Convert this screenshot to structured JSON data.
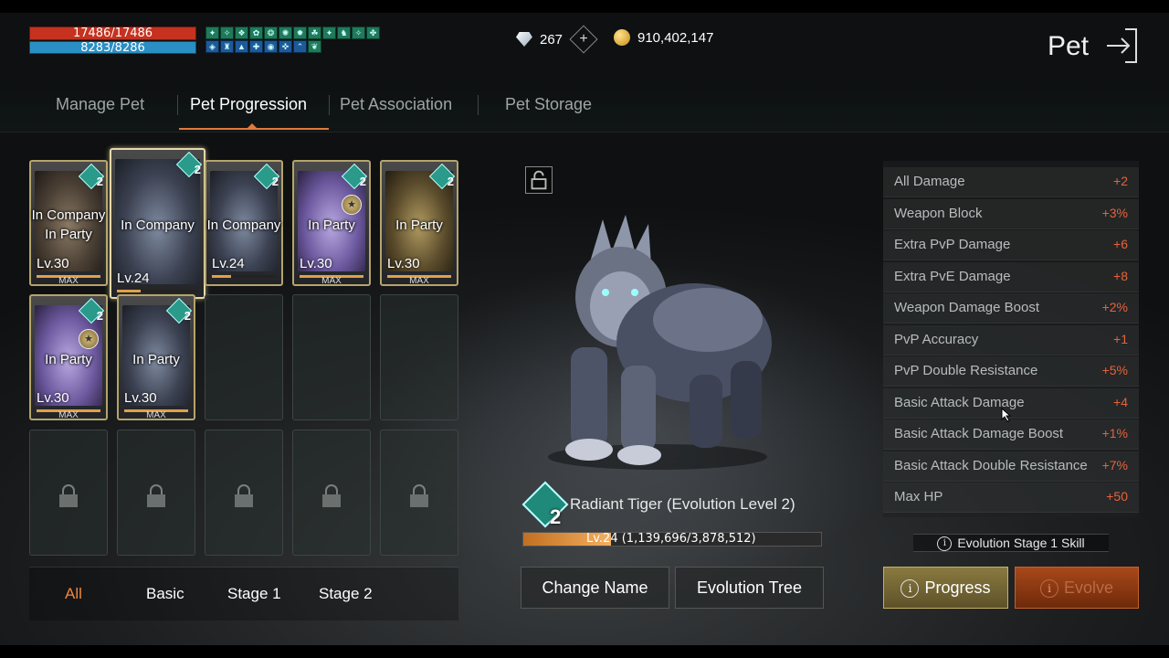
{
  "status": {
    "hp": "17486/17486",
    "mp": "8283/8286"
  },
  "buff_icons": [
    "buff-icon",
    "buff-icon",
    "buff-icon",
    "buff-icon",
    "buff-icon",
    "buff-icon",
    "buff-icon",
    "buff-icon",
    "buff-icon",
    "buff-icon",
    "buff-icon",
    "buff-icon",
    "buff-icon",
    "buff-icon",
    "buff-icon",
    "buff-icon",
    "buff-icon",
    "buff-icon",
    "buff-icon",
    "buff-icon",
    "buff-icon",
    "buff-icon",
    "buff-icon",
    "buff-icon"
  ],
  "currency": {
    "gems": "267",
    "gold": "910,402,147"
  },
  "page_title": "Pet",
  "tabs": [
    {
      "label": "Manage Pet"
    },
    {
      "label": "Pet Progression"
    },
    {
      "label": "Pet Association"
    },
    {
      "label": "Pet Storage"
    }
  ],
  "pets": [
    {
      "status1": "In Company",
      "status2": "In Party",
      "level": "Lv.30",
      "max": "MAX",
      "badge": "2",
      "xp": 1.0
    },
    {
      "status1": "In Company",
      "status2": "",
      "level": "Lv.24",
      "max": "",
      "badge": "2",
      "xp": 0.29
    },
    {
      "status1": "In Company",
      "status2": "",
      "level": "Lv.24",
      "max": "",
      "badge": "2",
      "xp": 0.3
    },
    {
      "status1": "In Party",
      "status2": "",
      "level": "Lv.30",
      "max": "MAX",
      "badge": "2",
      "xp": 1.0
    },
    {
      "status1": "In Party",
      "status2": "",
      "level": "Lv.30",
      "max": "MAX",
      "badge": "2",
      "xp": 1.0
    },
    {
      "status1": "In Party",
      "status2": "",
      "level": "Lv.30",
      "max": "MAX",
      "badge": "2",
      "xp": 1.0
    },
    {
      "status1": "In Party",
      "status2": "",
      "level": "Lv.30",
      "max": "MAX",
      "badge": "2",
      "xp": 1.0
    }
  ],
  "filters": {
    "all": "All",
    "basic": "Basic",
    "stage1": "Stage 1",
    "stage2": "Stage 2"
  },
  "selected_pet": {
    "badge": "2",
    "name": "Radiant Tiger (Evolution Level 2)",
    "exp_text": "Lv.24 (1,139,696/3,878,512)",
    "exp_fraction": 0.294
  },
  "buttons": {
    "change_name": "Change Name",
    "evolution_tree": "Evolution Tree",
    "progress": "Progress",
    "evolve": "Evolve"
  },
  "stats": [
    {
      "name": "All Damage",
      "value": "+2"
    },
    {
      "name": "Weapon Block",
      "value": "+3%"
    },
    {
      "name": "Extra PvP Damage",
      "value": "+6"
    },
    {
      "name": "Extra PvE Damage",
      "value": "+8"
    },
    {
      "name": "Weapon Damage Boost",
      "value": "+2%"
    },
    {
      "name": "PvP Accuracy",
      "value": "+1"
    },
    {
      "name": "PvP Double Resistance",
      "value": "+5%"
    },
    {
      "name": "Basic Attack Damage",
      "value": "+4"
    },
    {
      "name": "Basic Attack Damage Boost",
      "value": "+1%"
    },
    {
      "name": "Basic Attack Double Resistance",
      "value": "+7%"
    },
    {
      "name": "Max HP",
      "value": "+50"
    }
  ],
  "skill_label": "Evolution Stage 1 Skill",
  "colors": {
    "accent": "#e07a3a",
    "stat_value": "#e8623a",
    "hp": "#c5321f",
    "mp": "#2a8fc4"
  }
}
